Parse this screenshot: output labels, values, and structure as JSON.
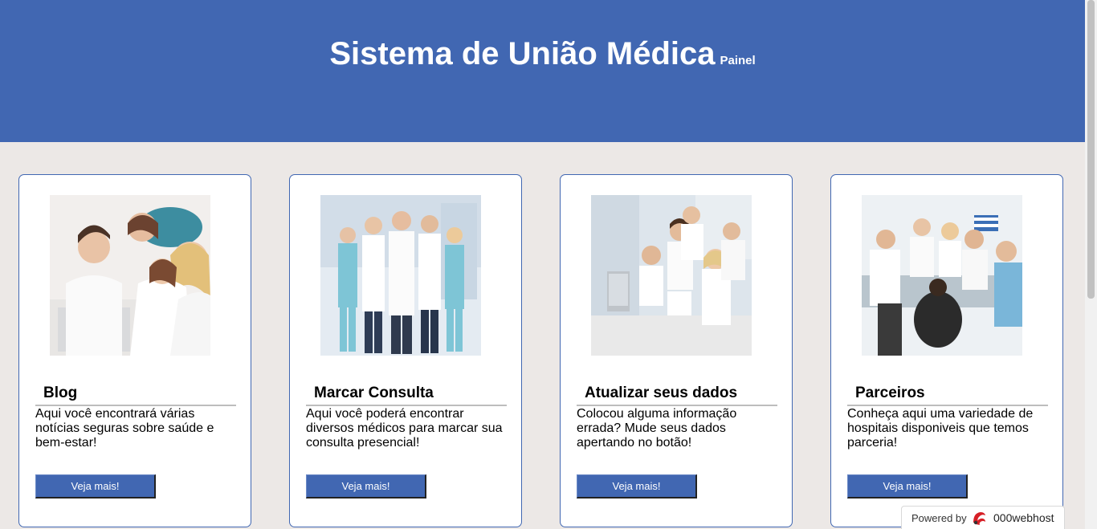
{
  "header": {
    "title": "Sistema de União Médica",
    "subtitle": "Painel",
    "background": "#4167b2"
  },
  "cards": [
    {
      "title": "Blog",
      "text": "Aqui você encontrará várias notícias seguras sobre saúde e bem-estar!",
      "button": "Veja mais!",
      "image": "doctors-at-laptop-photo"
    },
    {
      "title": "Marcar Consulta",
      "text": "Aqui você poderá encontrar diversos médicos para marcar sua consulta presencial!",
      "button": "Veja mais!",
      "image": "doctors-team-standing-photo"
    },
    {
      "title": "Atualizar seus dados",
      "text": "Colocou alguma informação errada? Mude seus dados apertando no botão!",
      "button": "Veja mais!",
      "image": "doctors-at-computers-photo"
    },
    {
      "title": "Parceiros",
      "text": "Conheça aqui uma variedade de hospitais disponiveis que temos parceria!",
      "button": "Veja mais!",
      "image": "doctors-meeting-photo"
    }
  ],
  "footer_badge": {
    "label": "Powered by",
    "brand": "000webhost",
    "icon": "000webhost-logo-icon"
  },
  "colors": {
    "accent": "#4167b2",
    "page_bg": "#ece8e6"
  }
}
